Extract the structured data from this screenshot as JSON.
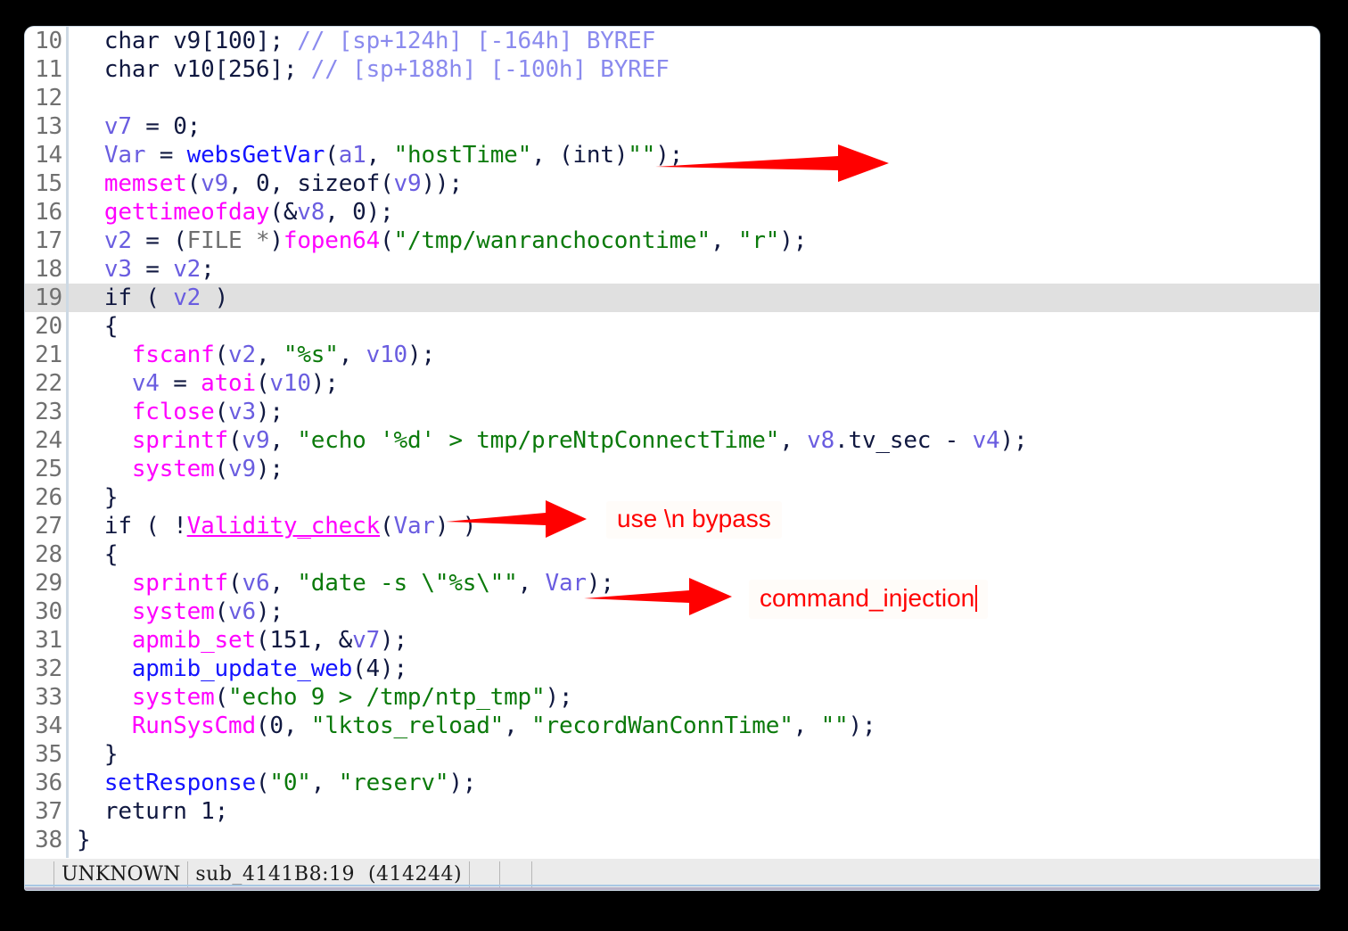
{
  "window": {
    "title": "IDA Pseudocode View"
  },
  "code": {
    "lines": [
      {
        "num": "10",
        "highlight": false,
        "tokens": [
          {
            "t": "  ",
            "c": "c-plain"
          },
          {
            "t": "char",
            "c": "c-kw"
          },
          {
            "t": " v9[100]; ",
            "c": "c-plain"
          },
          {
            "t": "// [sp+124h] [-164h] BYREF",
            "c": "c-cmt"
          }
        ]
      },
      {
        "num": "11",
        "highlight": false,
        "tokens": [
          {
            "t": "  ",
            "c": "c-plain"
          },
          {
            "t": "char",
            "c": "c-kw"
          },
          {
            "t": " v10[256]; ",
            "c": "c-plain"
          },
          {
            "t": "// [sp+188h] [-100h] BYREF",
            "c": "c-cmt"
          }
        ]
      },
      {
        "num": "12",
        "highlight": false,
        "tokens": [
          {
            "t": "",
            "c": "c-plain"
          }
        ]
      },
      {
        "num": "13",
        "highlight": false,
        "tokens": [
          {
            "t": "  ",
            "c": "c-plain"
          },
          {
            "t": "v7",
            "c": "c-var"
          },
          {
            "t": " = 0;",
            "c": "c-plain"
          }
        ]
      },
      {
        "num": "14",
        "highlight": false,
        "tokens": [
          {
            "t": "  ",
            "c": "c-plain"
          },
          {
            "t": "Var",
            "c": "c-var"
          },
          {
            "t": " = ",
            "c": "c-plain"
          },
          {
            "t": "websGetVar",
            "c": "c-usr"
          },
          {
            "t": "(",
            "c": "c-plain"
          },
          {
            "t": "a1",
            "c": "c-var"
          },
          {
            "t": ", ",
            "c": "c-plain"
          },
          {
            "t": "\"hostTime\"",
            "c": "c-str"
          },
          {
            "t": ", (",
            "c": "c-plain"
          },
          {
            "t": "int",
            "c": "c-kw"
          },
          {
            "t": ")",
            "c": "c-plain"
          },
          {
            "t": "\"\"",
            "c": "c-str"
          },
          {
            "t": ");",
            "c": "c-plain"
          }
        ]
      },
      {
        "num": "15",
        "highlight": false,
        "tokens": [
          {
            "t": "  ",
            "c": "c-plain"
          },
          {
            "t": "memset",
            "c": "c-lib"
          },
          {
            "t": "(",
            "c": "c-plain"
          },
          {
            "t": "v9",
            "c": "c-var"
          },
          {
            "t": ", 0, ",
            "c": "c-plain"
          },
          {
            "t": "sizeof",
            "c": "c-kw"
          },
          {
            "t": "(",
            "c": "c-plain"
          },
          {
            "t": "v9",
            "c": "c-var"
          },
          {
            "t": "));",
            "c": "c-plain"
          }
        ]
      },
      {
        "num": "16",
        "highlight": false,
        "tokens": [
          {
            "t": "  ",
            "c": "c-plain"
          },
          {
            "t": "gettimeofday",
            "c": "c-lib"
          },
          {
            "t": "(&",
            "c": "c-plain"
          },
          {
            "t": "v8",
            "c": "c-var"
          },
          {
            "t": ", 0);",
            "c": "c-plain"
          }
        ]
      },
      {
        "num": "17",
        "highlight": false,
        "tokens": [
          {
            "t": "  ",
            "c": "c-plain"
          },
          {
            "t": "v2",
            "c": "c-var"
          },
          {
            "t": " = (",
            "c": "c-plain"
          },
          {
            "t": "FILE *",
            "c": "c-type"
          },
          {
            "t": ")",
            "c": "c-plain"
          },
          {
            "t": "fopen64",
            "c": "c-lib"
          },
          {
            "t": "(",
            "c": "c-plain"
          },
          {
            "t": "\"/tmp/wanranchocontime\"",
            "c": "c-str"
          },
          {
            "t": ", ",
            "c": "c-plain"
          },
          {
            "t": "\"r\"",
            "c": "c-str"
          },
          {
            "t": ");",
            "c": "c-plain"
          }
        ]
      },
      {
        "num": "18",
        "highlight": false,
        "tokens": [
          {
            "t": "  ",
            "c": "c-plain"
          },
          {
            "t": "v3",
            "c": "c-var"
          },
          {
            "t": " = ",
            "c": "c-plain"
          },
          {
            "t": "v2",
            "c": "c-var"
          },
          {
            "t": ";",
            "c": "c-plain"
          }
        ]
      },
      {
        "num": "19",
        "highlight": true,
        "tokens": [
          {
            "t": "  ",
            "c": "c-plain"
          },
          {
            "t": "if",
            "c": "c-kw"
          },
          {
            "t": " ( ",
            "c": "c-plain"
          },
          {
            "t": "v2",
            "c": "c-var"
          },
          {
            "t": " )",
            "c": "c-plain"
          }
        ]
      },
      {
        "num": "20",
        "highlight": false,
        "tokens": [
          {
            "t": "  {",
            "c": "c-plain"
          }
        ]
      },
      {
        "num": "21",
        "highlight": false,
        "tokens": [
          {
            "t": "    ",
            "c": "c-plain"
          },
          {
            "t": "fscanf",
            "c": "c-lib"
          },
          {
            "t": "(",
            "c": "c-plain"
          },
          {
            "t": "v2",
            "c": "c-var"
          },
          {
            "t": ", ",
            "c": "c-plain"
          },
          {
            "t": "\"%s\"",
            "c": "c-str"
          },
          {
            "t": ", ",
            "c": "c-plain"
          },
          {
            "t": "v10",
            "c": "c-var"
          },
          {
            "t": ");",
            "c": "c-plain"
          }
        ]
      },
      {
        "num": "22",
        "highlight": false,
        "tokens": [
          {
            "t": "    ",
            "c": "c-plain"
          },
          {
            "t": "v4",
            "c": "c-var"
          },
          {
            "t": " = ",
            "c": "c-plain"
          },
          {
            "t": "atoi",
            "c": "c-lib"
          },
          {
            "t": "(",
            "c": "c-plain"
          },
          {
            "t": "v10",
            "c": "c-var"
          },
          {
            "t": ");",
            "c": "c-plain"
          }
        ]
      },
      {
        "num": "23",
        "highlight": false,
        "tokens": [
          {
            "t": "    ",
            "c": "c-plain"
          },
          {
            "t": "fclose",
            "c": "c-lib"
          },
          {
            "t": "(",
            "c": "c-plain"
          },
          {
            "t": "v3",
            "c": "c-var"
          },
          {
            "t": ");",
            "c": "c-plain"
          }
        ]
      },
      {
        "num": "24",
        "highlight": false,
        "tokens": [
          {
            "t": "    ",
            "c": "c-plain"
          },
          {
            "t": "sprintf",
            "c": "c-lib"
          },
          {
            "t": "(",
            "c": "c-plain"
          },
          {
            "t": "v9",
            "c": "c-var"
          },
          {
            "t": ", ",
            "c": "c-plain"
          },
          {
            "t": "\"echo '%d' > tmp/preNtpConnectTime\"",
            "c": "c-str"
          },
          {
            "t": ", ",
            "c": "c-plain"
          },
          {
            "t": "v8",
            "c": "c-var"
          },
          {
            "t": ".tv_sec - ",
            "c": "c-plain"
          },
          {
            "t": "v4",
            "c": "c-var"
          },
          {
            "t": ");",
            "c": "c-plain"
          }
        ]
      },
      {
        "num": "25",
        "highlight": false,
        "tokens": [
          {
            "t": "    ",
            "c": "c-plain"
          },
          {
            "t": "system",
            "c": "c-lib"
          },
          {
            "t": "(",
            "c": "c-plain"
          },
          {
            "t": "v9",
            "c": "c-var"
          },
          {
            "t": ");",
            "c": "c-plain"
          }
        ]
      },
      {
        "num": "26",
        "highlight": false,
        "tokens": [
          {
            "t": "  }",
            "c": "c-plain"
          }
        ]
      },
      {
        "num": "27",
        "highlight": false,
        "tokens": [
          {
            "t": "  ",
            "c": "c-plain"
          },
          {
            "t": "if",
            "c": "c-kw"
          },
          {
            "t": " ( !",
            "c": "c-plain"
          },
          {
            "t": "Validity_check",
            "c": "c-lib c-underline"
          },
          {
            "t": "(",
            "c": "c-plain"
          },
          {
            "t": "Var",
            "c": "c-var"
          },
          {
            "t": ") )",
            "c": "c-plain"
          }
        ]
      },
      {
        "num": "28",
        "highlight": false,
        "tokens": [
          {
            "t": "  {",
            "c": "c-plain"
          }
        ]
      },
      {
        "num": "29",
        "highlight": false,
        "tokens": [
          {
            "t": "    ",
            "c": "c-plain"
          },
          {
            "t": "sprintf",
            "c": "c-lib"
          },
          {
            "t": "(",
            "c": "c-plain"
          },
          {
            "t": "v6",
            "c": "c-var"
          },
          {
            "t": ", ",
            "c": "c-plain"
          },
          {
            "t": "\"date -s \\\"%s\\\"\"",
            "c": "c-str"
          },
          {
            "t": ", ",
            "c": "c-plain"
          },
          {
            "t": "Var",
            "c": "c-var"
          },
          {
            "t": ");",
            "c": "c-plain"
          }
        ]
      },
      {
        "num": "30",
        "highlight": false,
        "tokens": [
          {
            "t": "    ",
            "c": "c-plain"
          },
          {
            "t": "system",
            "c": "c-lib"
          },
          {
            "t": "(",
            "c": "c-plain"
          },
          {
            "t": "v6",
            "c": "c-var"
          },
          {
            "t": ");",
            "c": "c-plain"
          }
        ]
      },
      {
        "num": "31",
        "highlight": false,
        "tokens": [
          {
            "t": "    ",
            "c": "c-plain"
          },
          {
            "t": "apmib_set",
            "c": "c-lib"
          },
          {
            "t": "(151, &",
            "c": "c-plain"
          },
          {
            "t": "v7",
            "c": "c-var"
          },
          {
            "t": ");",
            "c": "c-plain"
          }
        ]
      },
      {
        "num": "32",
        "highlight": false,
        "tokens": [
          {
            "t": "    ",
            "c": "c-plain"
          },
          {
            "t": "apmib_update_web",
            "c": "c-usr"
          },
          {
            "t": "(4);",
            "c": "c-plain"
          }
        ]
      },
      {
        "num": "33",
        "highlight": false,
        "tokens": [
          {
            "t": "    ",
            "c": "c-plain"
          },
          {
            "t": "system",
            "c": "c-lib"
          },
          {
            "t": "(",
            "c": "c-plain"
          },
          {
            "t": "\"echo 9 > /tmp/ntp_tmp\"",
            "c": "c-str"
          },
          {
            "t": ");",
            "c": "c-plain"
          }
        ]
      },
      {
        "num": "34",
        "highlight": false,
        "tokens": [
          {
            "t": "    ",
            "c": "c-plain"
          },
          {
            "t": "RunSysCmd",
            "c": "c-lib"
          },
          {
            "t": "(0, ",
            "c": "c-plain"
          },
          {
            "t": "\"lktos_reload\"",
            "c": "c-str"
          },
          {
            "t": ", ",
            "c": "c-plain"
          },
          {
            "t": "\"recordWanConnTime\"",
            "c": "c-str"
          },
          {
            "t": ", ",
            "c": "c-plain"
          },
          {
            "t": "\"\"",
            "c": "c-str"
          },
          {
            "t": ");",
            "c": "c-plain"
          }
        ]
      },
      {
        "num": "35",
        "highlight": false,
        "tokens": [
          {
            "t": "  }",
            "c": "c-plain"
          }
        ]
      },
      {
        "num": "36",
        "highlight": false,
        "tokens": [
          {
            "t": "  ",
            "c": "c-plain"
          },
          {
            "t": "setResponse",
            "c": "c-usr"
          },
          {
            "t": "(",
            "c": "c-plain"
          },
          {
            "t": "\"0\"",
            "c": "c-str"
          },
          {
            "t": ", ",
            "c": "c-plain"
          },
          {
            "t": "\"reserv\"",
            "c": "c-str"
          },
          {
            "t": ");",
            "c": "c-plain"
          }
        ]
      },
      {
        "num": "37",
        "highlight": false,
        "tokens": [
          {
            "t": "  ",
            "c": "c-plain"
          },
          {
            "t": "return",
            "c": "c-kw"
          },
          {
            "t": " 1;",
            "c": "c-plain"
          }
        ]
      },
      {
        "num": "38",
        "highlight": false,
        "tokens": [
          {
            "t": "}",
            "c": "c-plain"
          }
        ]
      }
    ]
  },
  "status_bar": {
    "segment_unknown": "UNKNOWN",
    "segment_address": "sub_4141B8:19  (414244)"
  },
  "annotations": [
    {
      "id": "anno-1",
      "text": "",
      "arrow_only": true
    },
    {
      "id": "anno-2",
      "text": "use \\n bypass"
    },
    {
      "id": "anno-3",
      "text": "command_injection"
    }
  ],
  "colors": {
    "annotation_red": "#ff0000",
    "highlight_row": "#e0e0e0",
    "library_func": "#ff00ff",
    "user_func": "#1414ff",
    "string": "#0b7a0b",
    "variable": "#6a5de0",
    "comment": "#8a8aee",
    "status_bg": "#ebebeb"
  }
}
